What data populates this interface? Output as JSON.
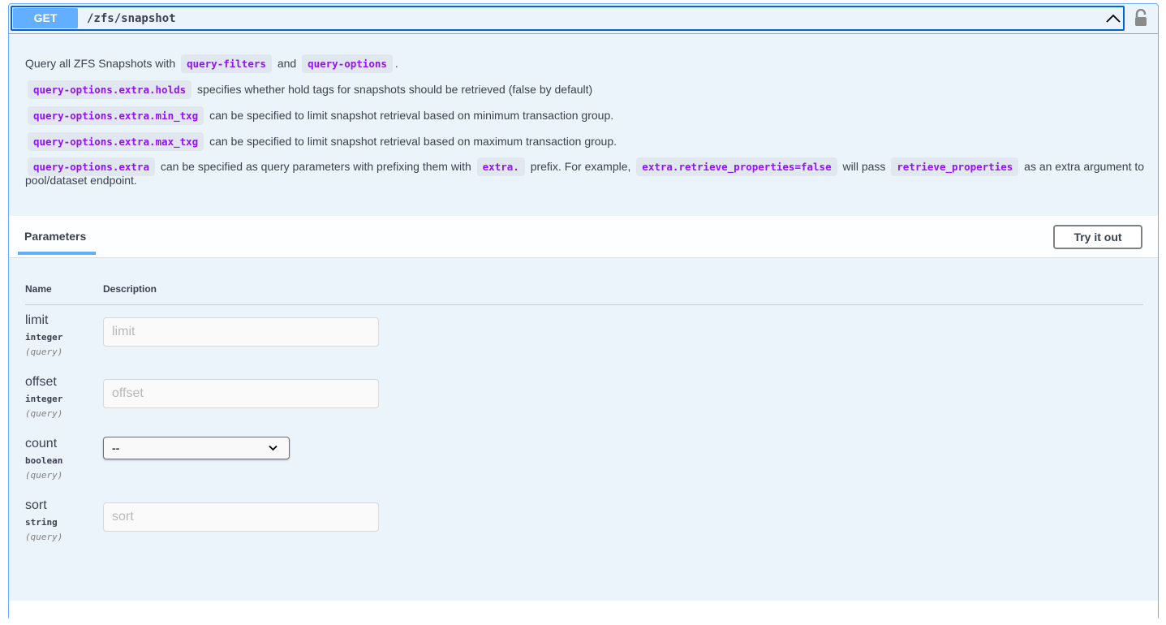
{
  "operation": {
    "method": "GET",
    "path": "/zfs/snapshot"
  },
  "description": {
    "line1": {
      "text_a": "Query all ZFS Snapshots with",
      "code_a": "query-filters",
      "text_b": "and",
      "code_b": "query-options",
      "text_c": "."
    },
    "line2": {
      "code": "query-options.extra.holds",
      "text": "specifies whether hold tags for snapshots should be retrieved (false by default)"
    },
    "line3": {
      "code": "query-options.extra.min_txg",
      "text": "can be specified to limit snapshot retrieval based on minimum transaction group."
    },
    "line4": {
      "code": "query-options.extra.max_txg",
      "text": "can be specified to limit snapshot retrieval based on maximum transaction group."
    },
    "line5": {
      "code_a": "query-options.extra",
      "text_a": "can be specified as query parameters with prefixing them with",
      "code_b": "extra.",
      "text_b": "prefix. For example,",
      "code_c": "extra.retrieve_properties=false",
      "text_c": "will pass",
      "code_d": "retrieve_properties",
      "text_d": "as an extra argument to pool/dataset endpoint."
    }
  },
  "parameters": {
    "tab_label": "Parameters",
    "try_label": "Try it out",
    "col_name": "Name",
    "col_description": "Description",
    "items": [
      {
        "name": "limit",
        "type": "integer",
        "in": "(query)",
        "placeholder": "limit"
      },
      {
        "name": "offset",
        "type": "integer",
        "in": "(query)",
        "placeholder": "offset"
      },
      {
        "name": "count",
        "type": "boolean",
        "in": "(query)",
        "selected": "--"
      },
      {
        "name": "sort",
        "type": "string",
        "in": "(query)",
        "placeholder": "sort"
      }
    ]
  }
}
